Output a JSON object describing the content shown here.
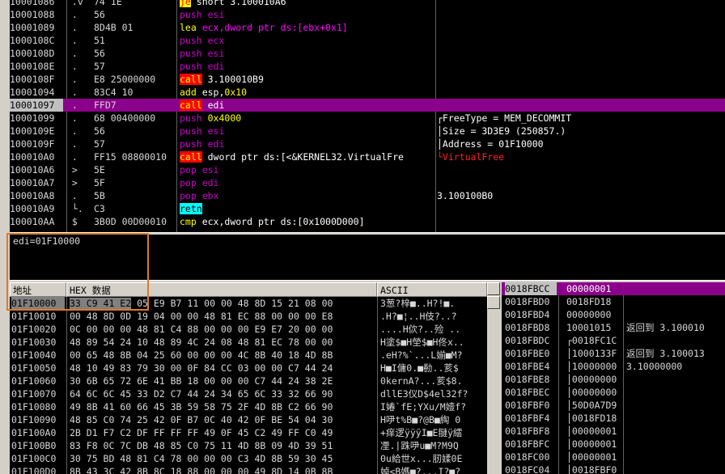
{
  "disasm": {
    "rows": [
      {
        "addr": "10001086",
        "arrow": " .v",
        "bytes": "74 1E",
        "mn": "je",
        "mcls": "je",
        "ops": " short 3.100010A6",
        "ocls": "op",
        "comment": ""
      },
      {
        "addr": "10001088",
        "arrow": " .",
        "bytes": "56",
        "mn": "push",
        "mcls": "push",
        "ops": " esi",
        "ocls": "push",
        "comment": ""
      },
      {
        "addr": "10001089",
        "arrow": " .",
        "bytes": "8D4B 01",
        "mn": "lea",
        "mcls": "lea",
        "ops": " ecx,dword ptr ds:[ebx+0x1]",
        "ocls": "lea",
        "comment": ""
      },
      {
        "addr": "1000108C",
        "arrow": " .",
        "bytes": "51",
        "mn": "push",
        "mcls": "push",
        "ops": " ecx",
        "ocls": "push",
        "comment": ""
      },
      {
        "addr": "1000108D",
        "arrow": " .",
        "bytes": "56",
        "mn": "push",
        "mcls": "push",
        "ops": " esi",
        "ocls": "push",
        "comment": ""
      },
      {
        "addr": "1000108E",
        "arrow": " .",
        "bytes": "57",
        "mn": "push",
        "mcls": "push",
        "ops": " edi",
        "ocls": "push",
        "comment": ""
      },
      {
        "addr": "1000108F",
        "arrow": " .",
        "bytes": "E8 25000000",
        "mn": "call",
        "mcls": "call",
        "ops": " 3.100010B9",
        "ocls": "op",
        "comment": ""
      },
      {
        "addr": "10001094",
        "arrow": " .",
        "bytes": "83C4 10",
        "mn": "add",
        "mcls": "add",
        "ops": " esp,0x10",
        "ocls": "add",
        "comment": ""
      },
      {
        "addr": "10001097",
        "arrow": " .",
        "bytes": "FFD7",
        "mn": "call",
        "mcls": "call",
        "ops": " edi",
        "ocls": "op",
        "comment": "",
        "sel": true
      },
      {
        "addr": "10001099",
        "arrow": " .",
        "bytes": "68 00400000",
        "mn": "push",
        "mcls": "push",
        "ops": " 0x4000",
        "ocls": "num",
        "comment": "┌FreeType = MEM_DECOMMIT"
      },
      {
        "addr": "1000109E",
        "arrow": " .",
        "bytes": "56",
        "mn": "push",
        "mcls": "push",
        "ops": " esi",
        "ocls": "push",
        "comment": "│Size = 3D3E9 (250857.)"
      },
      {
        "addr": "1000109F",
        "arrow": " .",
        "bytes": "57",
        "mn": "push",
        "mcls": "push",
        "ops": " edi",
        "ocls": "push",
        "comment": "│Address = 01F10000"
      },
      {
        "addr": "100010A0",
        "arrow": " .",
        "bytes": "FF15 08800010",
        "mn": "call",
        "mcls": "call",
        "ops": " dword ptr ds:[<&KERNEL32.VirtualFre",
        "ocls": "op",
        "comment": "└VirtualFree",
        "ccls": "red"
      },
      {
        "addr": "100010A6",
        "arrow": " >",
        "bytes": "5E",
        "mn": "pop",
        "mcls": "pop",
        "ops": " esi",
        "ocls": "push",
        "comment": ""
      },
      {
        "addr": "100010A7",
        "arrow": " >",
        "bytes": "5F",
        "mn": "pop",
        "mcls": "pop",
        "ops": " edi",
        "ocls": "push",
        "comment": ""
      },
      {
        "addr": "100010A8",
        "arrow": " .",
        "bytes": "5B",
        "mn": "pop",
        "mcls": "pop",
        "ops": " ebx",
        "ocls": "push",
        "comment": "3.100100B0"
      },
      {
        "addr": "100010A9",
        "arrow": " └.",
        "bytes": "C3",
        "mn": "retn",
        "mcls": "retn",
        "ops": "",
        "ocls": "op",
        "comment": ""
      },
      {
        "addr": "100010AA",
        "arrow": " $",
        "bytes": "3B0D 00D00010",
        "mn": "cmp",
        "mcls": "cmp",
        "ops": " ecx,dword ptr ds:[0x1000D000]",
        "ocls": "op",
        "comment": ""
      }
    ]
  },
  "info": {
    "text": "edi=01F10000"
  },
  "dump": {
    "header_addr": "地址",
    "header_hex": "HEX 数据",
    "header_ascii": "ASCII",
    "rows": [
      {
        "addr": "01F10000",
        "hex": "33 C9 41 E2 05 E9 B7 11 00 00 48 8D 15 21 08 00",
        "ascii": "3葱?梓■..H?!■."
      },
      {
        "addr": "01F10010",
        "hex": "00 48 8D 0D 19 04 00 00 48 81 EC 88 00 00 00 E8",
        "ascii": ".H?■¦..H伎?..?"
      },
      {
        "addr": "01F10020",
        "hex": "0C 00 00 00 48 81 C4 88 00 00 00 E9 E7 20 00 00",
        "ascii": "....H佽?..殓 .."
      },
      {
        "addr": "01F10030",
        "hex": "48 89 54 24 10 48 89 4C 24 08 48 81 EC 78 00 00",
        "ascii": "H塗$■H塋$■H佟x.."
      },
      {
        "addr": "01F10040",
        "hex": "00 65 48 8B 04 25 60 00 00 00 4C 8B 40 18 4D 8B",
        "ascii": ".eH?%`...L媊■M?"
      },
      {
        "addr": "01F10050",
        "hex": "48 10 49 83 79 30 00 0F 84 CC 03 00 00 C7 44 24",
        "ascii": "H■I傭0.■勌..荄$"
      },
      {
        "addr": "01F10060",
        "hex": "30 6B 65 72 6E 41 BB 18 00 00 00 C7 44 24 38 2E",
        "ascii": "0kernA?...荄$8."
      },
      {
        "addr": "01F10070",
        "hex": "64 6C 6C 45 33 D2 C7 44 24 34 65 6C 33 32 66 90",
        "ascii": "dllE3仪D$4el32f?"
      },
      {
        "addr": "01F10080",
        "hex": "49 8B 41 60 66 45 3B 59 58 75 2F 4D 8B C2 66 90",
        "ascii": "I媋`fE;YXu/M嬄f?"
      },
      {
        "addr": "01F10090",
        "hex": "48 85 C0 74 25 42 0F B7 0C 40 42 0F BE 54 04 30",
        "ascii": "H吚t%B■?@B■綯 0"
      },
      {
        "addr": "01F100A0",
        "hex": "2B D1 F7 C2 DF FF FF FF 49 0F 45 C2 49 FF C0 49",
        "ascii": "+痒逻ÿÿÿI■E翴ÿ繧"
      },
      {
        "addr": "01F100B0",
        "hex": "83 F8 0C 7C DB 48 85 C0 75 11 4D 8B 09 4D 39 51",
        "ascii": "凐.|跦吚u■M?M9Q"
      },
      {
        "addr": "01F100C0",
        "hex": "30 75 BD 48 81 C4 78 00 00 00 C3 4D 8B 59 30 45",
        "ascii": "0u給世x...肕媃0E"
      },
      {
        "addr": "01F100D0",
        "hex": "8B 43 3C 42 8B 8C 18 88 00 00 00 49 8D 14 0B 8B",
        "ascii": "婥<B媽■?...I?■?"
      }
    ]
  },
  "stack": {
    "rows": [
      {
        "addr": "0018FBCC",
        "val": "00000001",
        "cmt": "",
        "sel": true
      },
      {
        "addr": "0018FBD0",
        "val": "0018FD18",
        "cmt": ""
      },
      {
        "addr": "0018FBD4",
        "val": "00000000",
        "cmt": ""
      },
      {
        "addr": "0018FBD8",
        "val": "10001015",
        "cmt": "返回到 3.100010"
      },
      {
        "addr": "0018FBDC",
        "val": "┌0018FC1C",
        "cmt": ""
      },
      {
        "addr": "0018FBE0",
        "val": "│1000133F",
        "cmt": "返回到 3.100013"
      },
      {
        "addr": "0018FBE4",
        "val": "│10000000",
        "cmt": "3.10000000"
      },
      {
        "addr": "0018FBE8",
        "val": "│00000000",
        "cmt": ""
      },
      {
        "addr": "0018FBEC",
        "val": "│00000000",
        "cmt": ""
      },
      {
        "addr": "0018FBF0",
        "val": "│50D0A7D9",
        "cmt": ""
      },
      {
        "addr": "0018FBF4",
        "val": "│0018FD18",
        "cmt": ""
      },
      {
        "addr": "0018FBF8",
        "val": "│00000001",
        "cmt": ""
      },
      {
        "addr": "0018FBFC",
        "val": "│00000001",
        "cmt": ""
      },
      {
        "addr": "0018FC00",
        "val": "│00000001",
        "cmt": ""
      },
      {
        "addr": "0018FC04",
        "val": "│0018FBF0",
        "cmt": ""
      }
    ]
  }
}
